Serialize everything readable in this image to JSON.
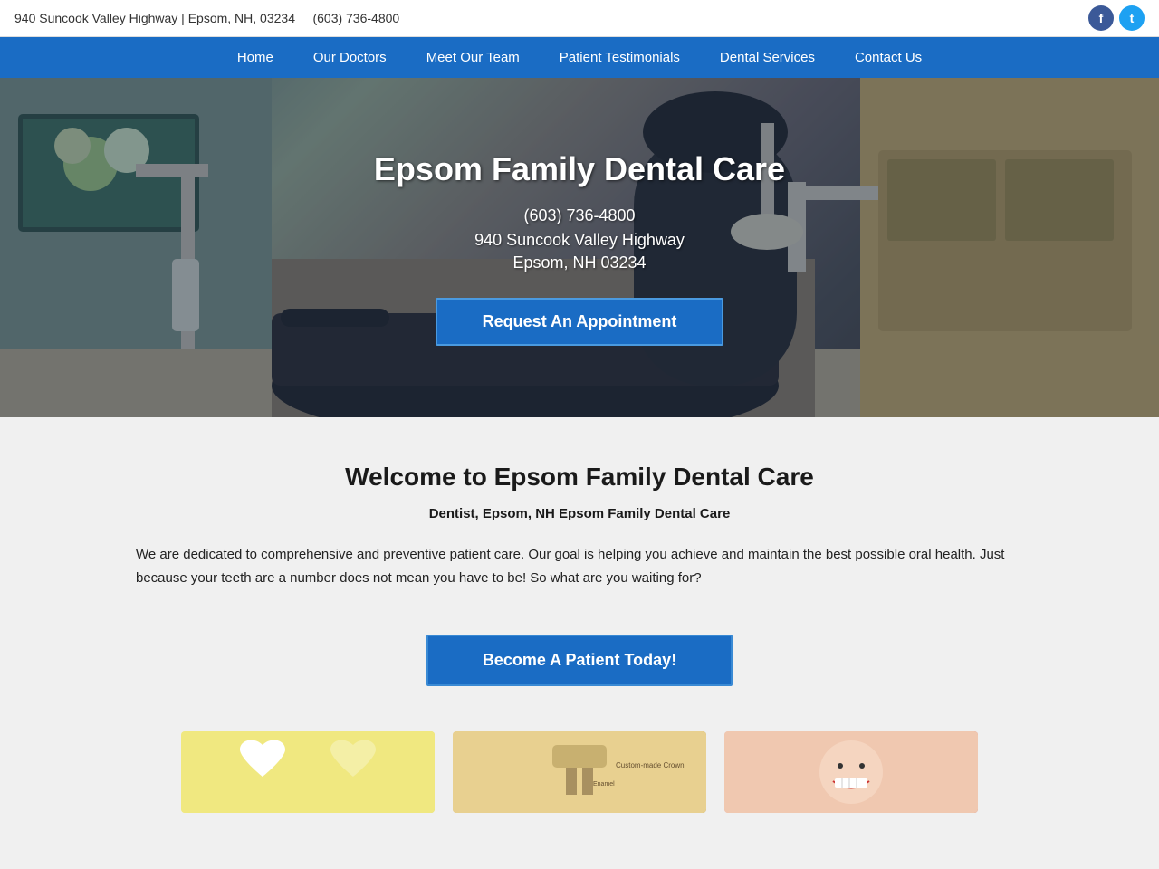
{
  "topbar": {
    "address": "940 Suncook Valley Highway | Epsom, NH, 03234",
    "phone": "(603) 736-4800"
  },
  "social": {
    "facebook_label": "f",
    "twitter_label": "t"
  },
  "nav": {
    "items": [
      {
        "label": "Home",
        "id": "home"
      },
      {
        "label": "Our Doctors",
        "id": "our-doctors"
      },
      {
        "label": "Meet Our Team",
        "id": "meet-our-team"
      },
      {
        "label": "Patient Testimonials",
        "id": "patient-testimonials"
      },
      {
        "label": "Dental Services",
        "id": "dental-services"
      },
      {
        "label": "Contact Us",
        "id": "contact-us"
      }
    ]
  },
  "hero": {
    "title": "Epsom Family Dental Care",
    "phone": "(603) 736-4800",
    "address1": "940 Suncook Valley Highway",
    "address2": "Epsom, NH 03234",
    "cta_button": "Request An Appointment"
  },
  "main": {
    "welcome_title": "Welcome to Epsom Family Dental Care",
    "welcome_subtitle": "Dentist, Epsom, NH Epsom Family Dental Care",
    "welcome_text": "We are dedicated to comprehensive and preventive patient care. Our goal is helping you achieve and maintain the best possible oral health. Just because your teeth are a number does not mean you have to be! So what are you waiting for?",
    "become_patient_button": "Become A Patient Today!"
  }
}
